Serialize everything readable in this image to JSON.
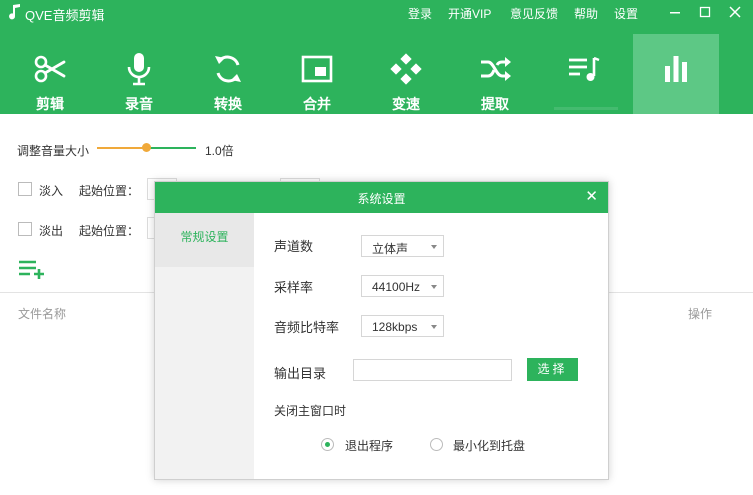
{
  "app": {
    "title": "QVE音频剪辑",
    "menu": [
      "登录",
      "开通VIP",
      "意见反馈",
      "帮助",
      "设置"
    ],
    "window_controls": [
      "minimize",
      "maximize",
      "close"
    ]
  },
  "toolbar": {
    "items": [
      {
        "label": "剪辑",
        "icon": "scissors-icon"
      },
      {
        "label": "录音",
        "icon": "microphone-icon"
      },
      {
        "label": "转换",
        "icon": "refresh-icon"
      },
      {
        "label": "合并",
        "icon": "merge-icon"
      },
      {
        "label": "变速",
        "icon": "speed-icon"
      },
      {
        "label": "提取",
        "icon": "shuffle-icon"
      },
      {
        "label": "",
        "icon": "playlist-icon"
      },
      {
        "label": "",
        "icon": "equalizer-icon",
        "active": true
      }
    ]
  },
  "volume": {
    "label": "调整音量大小",
    "value_text": "1.0倍",
    "slider_fraction": 0.5
  },
  "fade_in": {
    "label": "淡入",
    "start_label": "起始位置：",
    "checked": false
  },
  "fade_out": {
    "label": "淡出",
    "start_label": "起始位置：",
    "checked": false
  },
  "list": {
    "col_filename": "文件名称",
    "col_action": "操作"
  },
  "dialog": {
    "title": "系统设置",
    "side_tab": "常规设置",
    "channels_label": "声道数",
    "channels_value": "立体声",
    "samplerate_label": "采样率",
    "samplerate_value": "44100Hz",
    "bitrate_label": "音频比特率",
    "bitrate_value": "128kbps",
    "outdir_label": "输出目录",
    "outdir_value": "",
    "choose_label": "选择",
    "on_close_label": "关闭主窗口时",
    "option_exit": "退出程序",
    "option_tray": "最小化到托盘",
    "selected_option": "exit"
  },
  "colors": {
    "brand_green": "#2db35c",
    "slider_orange": "#f0a93a"
  }
}
